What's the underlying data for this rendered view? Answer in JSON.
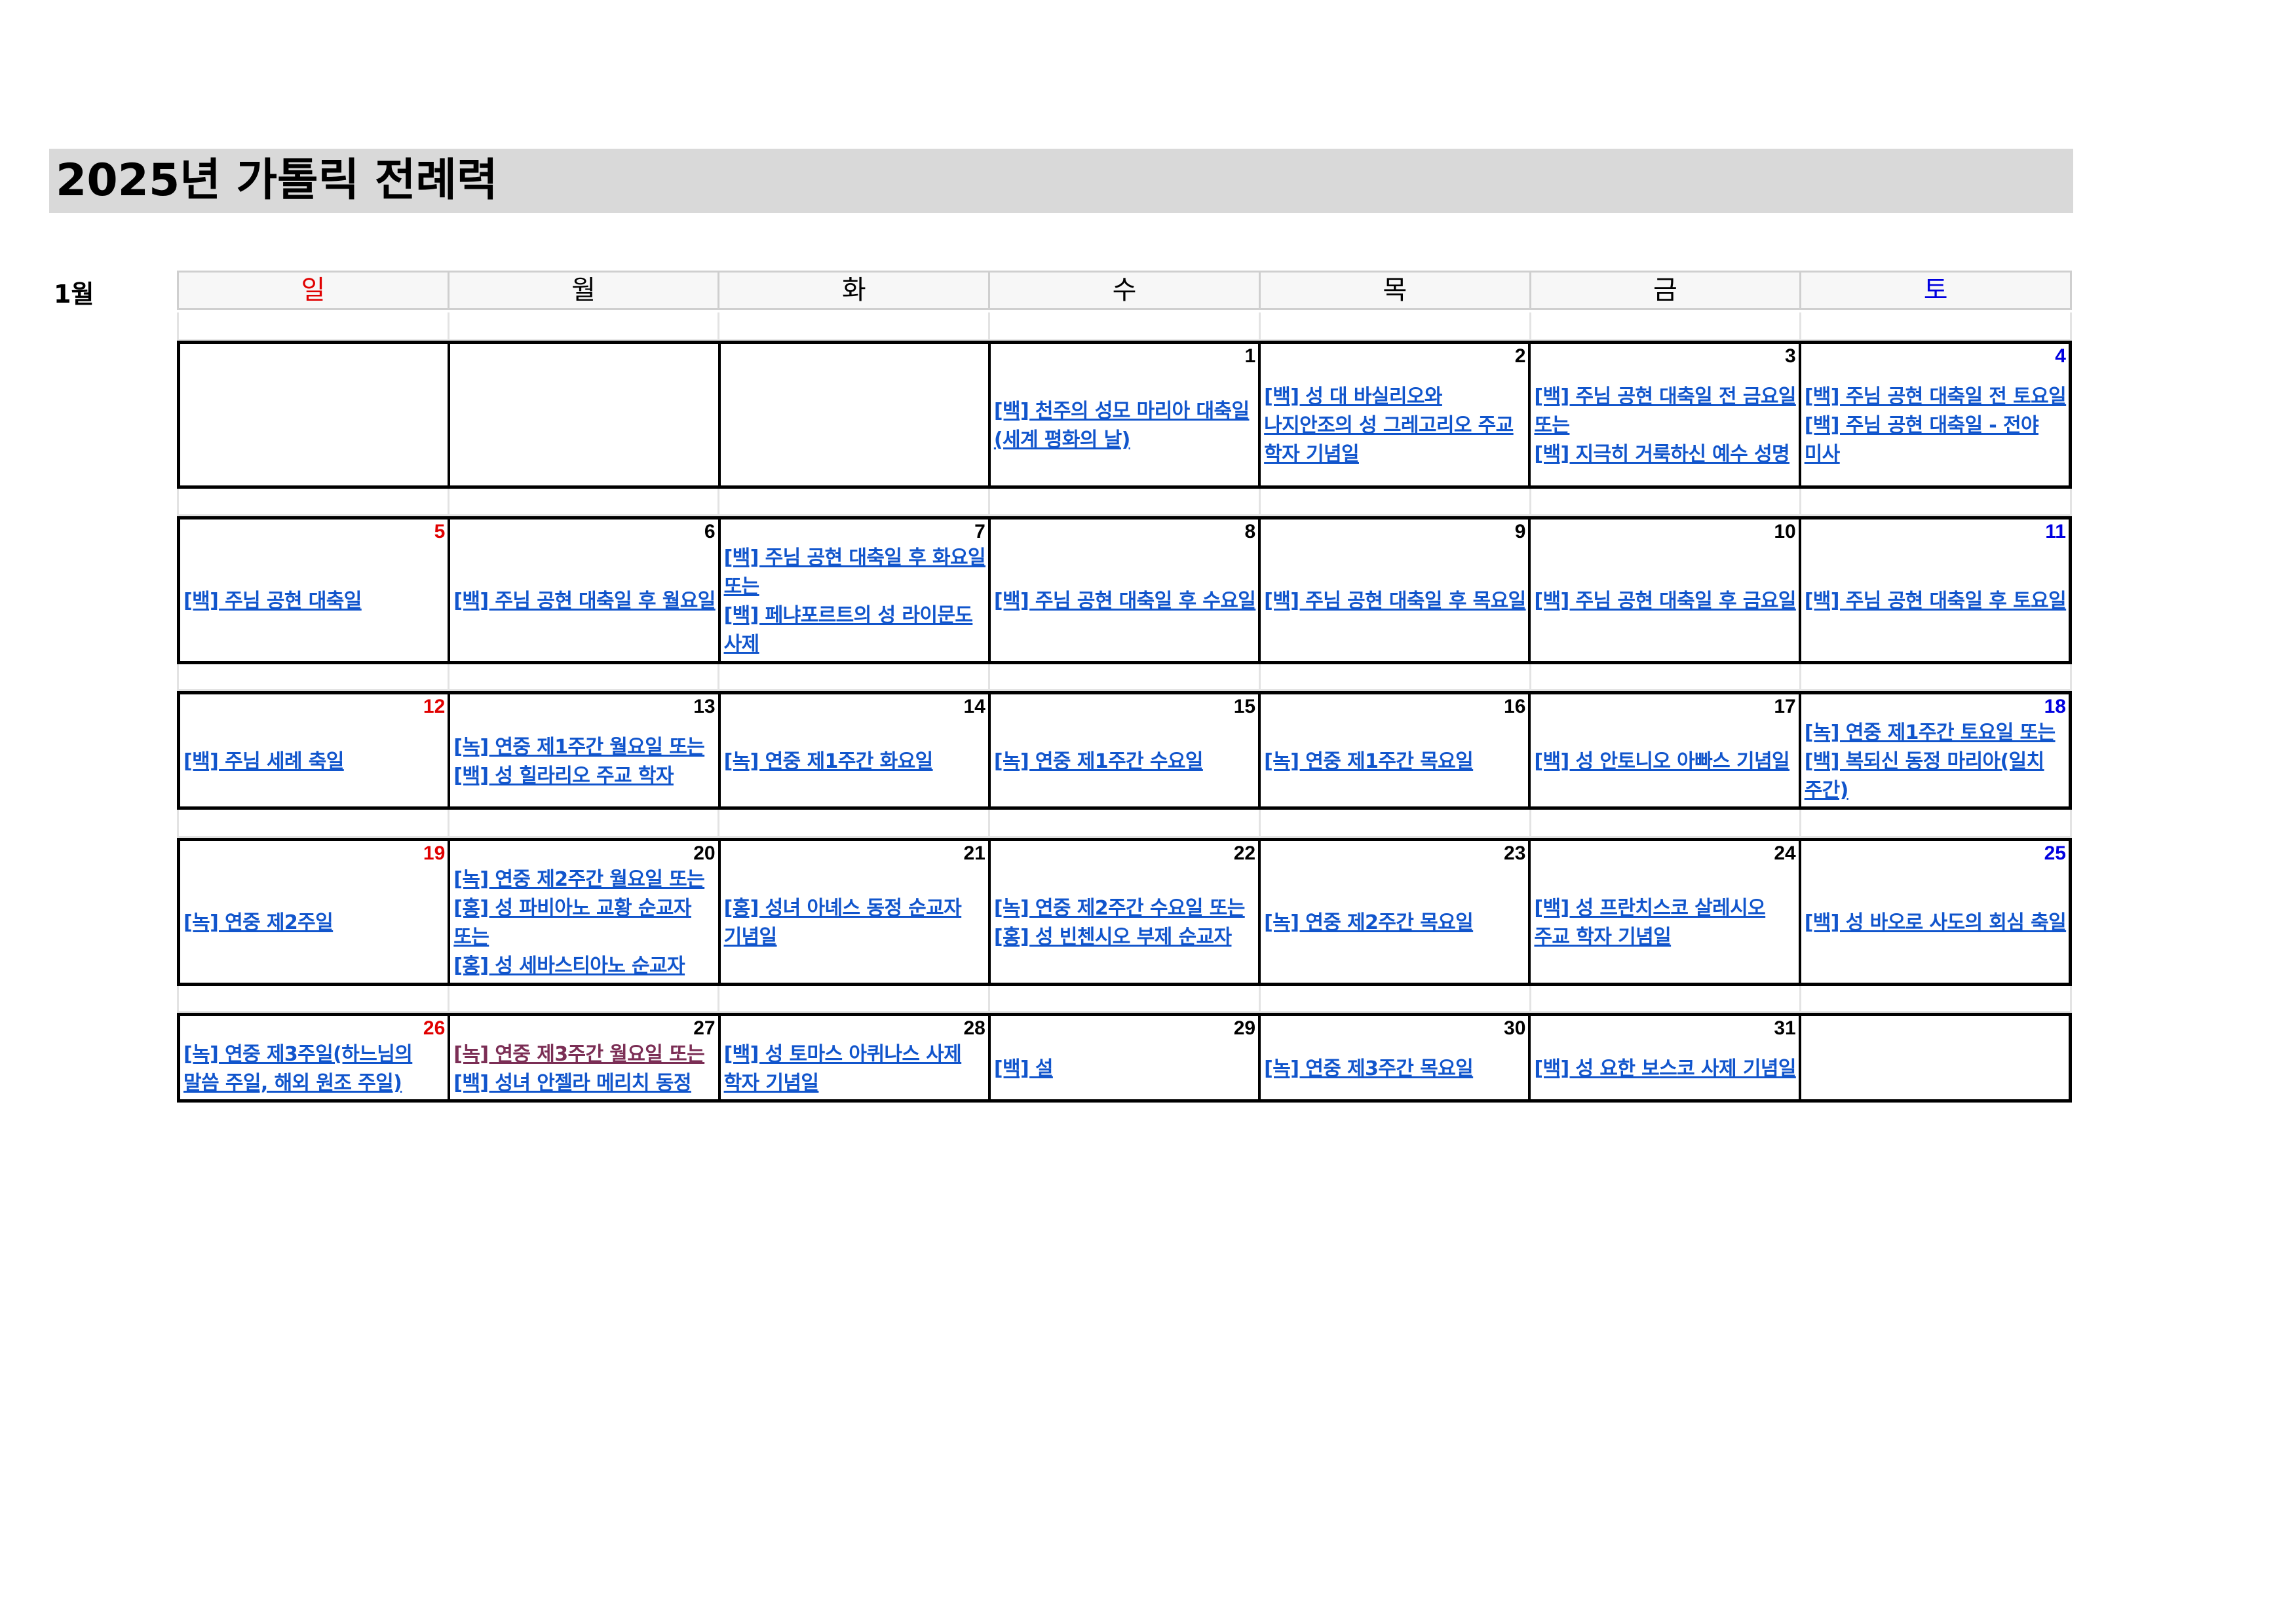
{
  "title": "2025년 가톨릭 전례력",
  "month_label": "1월",
  "weekdays": [
    "일",
    "월",
    "화",
    "수",
    "목",
    "금",
    "토"
  ],
  "weeks": [
    {
      "days": [
        {
          "num": "",
          "events": []
        },
        {
          "num": "",
          "events": []
        },
        {
          "num": "",
          "events": []
        },
        {
          "num": "1",
          "events": [
            {
              "text": "[백] 천주의 성모 마리아 대축일(세계 평화의 날)"
            }
          ]
        },
        {
          "num": "2",
          "events": [
            {
              "text": "[백] 성 대 바실리오와 나지안조의 성 그레고리오 주교 학자 기념일"
            }
          ]
        },
        {
          "num": "3",
          "events": [
            {
              "text": "[백] 주님 공현 대축일 전 금요일 또는"
            },
            {
              "text": "[백] 지극히 거룩하신 예수 성명"
            }
          ]
        },
        {
          "num": "4",
          "events": [
            {
              "text": "[백] 주님 공현 대축일 전 토요일"
            },
            {
              "text": "[백] 주님 공현 대축일 - 전야 미사"
            }
          ]
        }
      ]
    },
    {
      "days": [
        {
          "num": "5",
          "events": [
            {
              "text": "[백] 주님 공현 대축일"
            }
          ]
        },
        {
          "num": "6",
          "events": [
            {
              "text": "[백] 주님 공현 대축일 후 월요일"
            }
          ]
        },
        {
          "num": "7",
          "events": [
            {
              "text": "[백] 주님 공현 대축일 후 화요일 또는"
            },
            {
              "text": "[백] 페냐포르트의 성 라이문도 사제"
            }
          ]
        },
        {
          "num": "8",
          "events": [
            {
              "text": "[백] 주님 공현 대축일 후 수요일"
            }
          ]
        },
        {
          "num": "9",
          "events": [
            {
              "text": "[백] 주님 공현 대축일 후 목요일"
            }
          ]
        },
        {
          "num": "10",
          "events": [
            {
              "text": "[백] 주님 공현 대축일 후 금요일"
            }
          ]
        },
        {
          "num": "11",
          "events": [
            {
              "text": "[백] 주님 공현 대축일 후 토요일"
            }
          ]
        }
      ]
    },
    {
      "days": [
        {
          "num": "12",
          "events": [
            {
              "text": "[백] 주님 세례 축일"
            }
          ]
        },
        {
          "num": "13",
          "events": [
            {
              "text": "[녹] 연중 제1주간 월요일 또는"
            },
            {
              "text": "[백] 성 힐라리오 주교 학자"
            }
          ]
        },
        {
          "num": "14",
          "events": [
            {
              "text": "[녹] 연중 제1주간 화요일"
            }
          ]
        },
        {
          "num": "15",
          "events": [
            {
              "text": "[녹] 연중 제1주간 수요일"
            }
          ]
        },
        {
          "num": "16",
          "events": [
            {
              "text": "[녹] 연중 제1주간 목요일"
            }
          ]
        },
        {
          "num": "17",
          "events": [
            {
              "text": "[백] 성 안토니오 아빠스 기념일"
            }
          ]
        },
        {
          "num": "18",
          "events": [
            {
              "text": "[녹] 연중 제1주간 토요일 또는"
            },
            {
              "text": "[백] 복되신 동정 마리아(일치 주간)"
            }
          ]
        }
      ]
    },
    {
      "days": [
        {
          "num": "19",
          "events": [
            {
              "text": "[녹] 연중 제2주일"
            }
          ]
        },
        {
          "num": "20",
          "events": [
            {
              "text": "[녹] 연중 제2주간 월요일 또는"
            },
            {
              "text": "[홍] 성 파비아노 교황 순교자 또는"
            },
            {
              "text": "[홍] 성 세바스티아노 순교자"
            }
          ]
        },
        {
          "num": "21",
          "events": [
            {
              "text": "[홍] 성녀 아녜스 동정 순교자 기념일"
            }
          ]
        },
        {
          "num": "22",
          "events": [
            {
              "text": "[녹] 연중 제2주간 수요일 또는"
            },
            {
              "text": "[홍] 성 빈첸시오 부제 순교자"
            }
          ]
        },
        {
          "num": "23",
          "events": [
            {
              "text": "[녹] 연중 제2주간 목요일"
            }
          ]
        },
        {
          "num": "24",
          "events": [
            {
              "text": "[백] 성 프란치스코 살레시오 주교 학자 기념일"
            }
          ]
        },
        {
          "num": "25",
          "events": [
            {
              "text": "[백] 성 바오로 사도의 회심 축일"
            }
          ]
        }
      ]
    },
    {
      "days": [
        {
          "num": "26",
          "events": [
            {
              "text": "[녹] 연중 제3주일(하느님의 말씀 주일, 해외 원조 주일)"
            }
          ]
        },
        {
          "num": "27",
          "events": [
            {
              "text": "[녹] 연중 제3주간 월요일 또는",
              "visited": true
            },
            {
              "text": "[백] 성녀 안젤라 메리치 동정"
            }
          ]
        },
        {
          "num": "28",
          "events": [
            {
              "text": "[백] 성 토마스 아퀴나스 사제 학자 기념일"
            }
          ]
        },
        {
          "num": "29",
          "events": [
            {
              "text": "[백] 설"
            }
          ]
        },
        {
          "num": "30",
          "events": [
            {
              "text": "[녹] 연중 제3주간 목요일"
            }
          ]
        },
        {
          "num": "31",
          "events": [
            {
              "text": "[백] 성 요한 보스코 사제 기념일"
            }
          ]
        },
        {
          "num": "",
          "events": []
        }
      ]
    }
  ]
}
